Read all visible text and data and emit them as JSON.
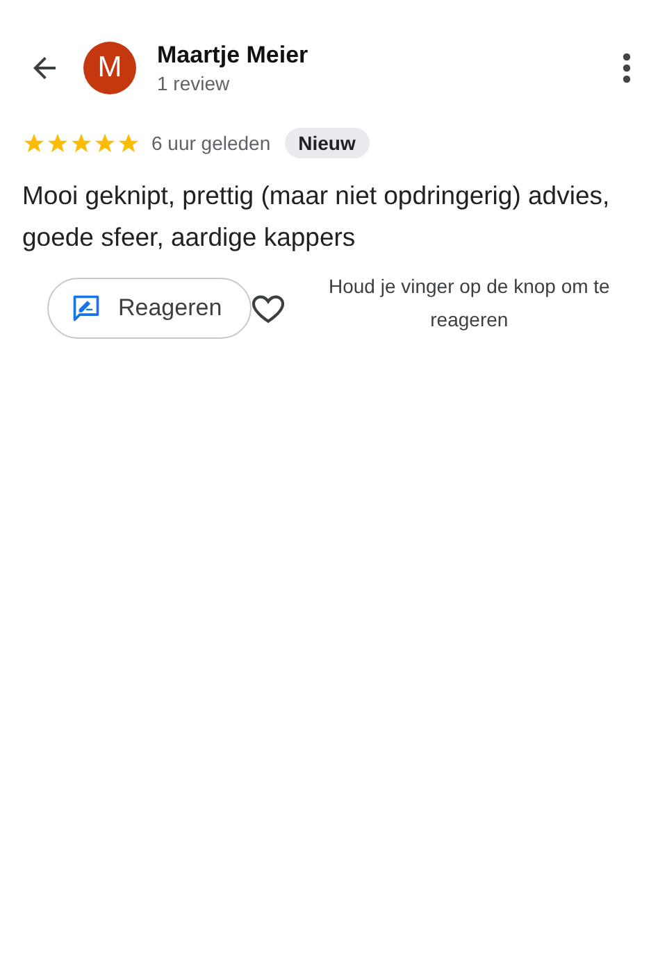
{
  "reviewer": {
    "initial": "M",
    "name": "Maartje Meier",
    "subtitle": "1 review"
  },
  "review": {
    "stars": 5,
    "time": "6 uur geleden",
    "badge": "Nieuw",
    "text": "Mooi geknipt, prettig (maar niet opdringerig) advies, goede sfeer, aardige kappers"
  },
  "actions": {
    "reply_label": "Reageren",
    "hint": "Houd je vinger op de knop om te reageren"
  }
}
